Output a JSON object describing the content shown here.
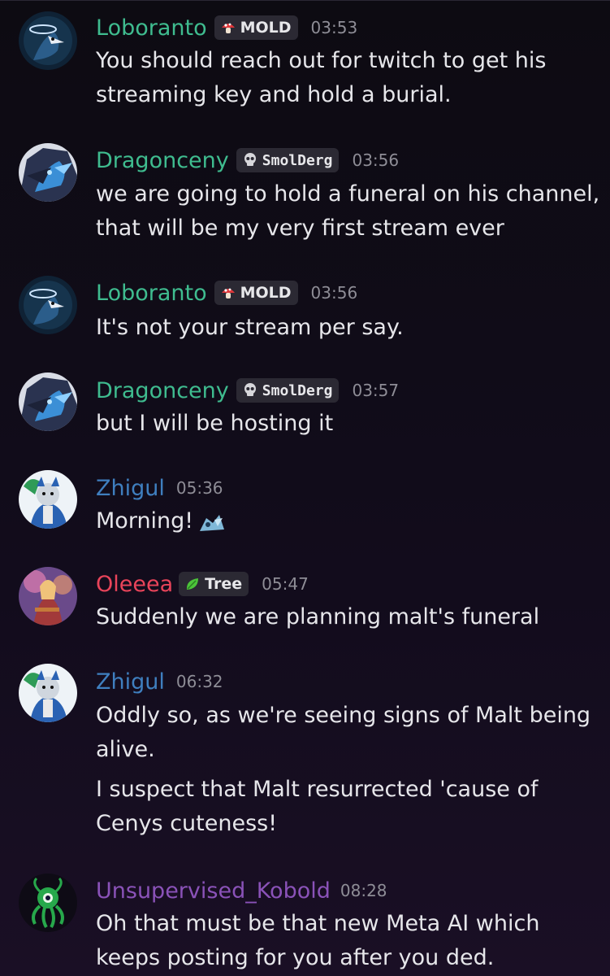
{
  "colors": {
    "loboranto": "#3fbc8f",
    "dragonceny": "#3fbc8f",
    "zhigul": "#3f7fbf",
    "oleeea": "#e9445a",
    "kobold": "#8a52b8"
  },
  "messages": [
    {
      "name": "Loboranto",
      "tag": "MOLD",
      "tag_icon": "mushroom-icon",
      "time": "03:53",
      "lines": [
        "You should reach out for twitch to get his",
        "streaming key and hold a burial."
      ]
    },
    {
      "name": "Dragonceny",
      "tag": "SmolDerg",
      "tag_icon": "skull-icon",
      "time": "03:56",
      "lines": [
        "we are going to hold a funeral on his channel,",
        "that will be my very first stream ever"
      ]
    },
    {
      "name": "Loboranto",
      "tag": "MOLD",
      "tag_icon": "mushroom-icon",
      "time": "03:56",
      "lines": [
        "It's not your stream per say."
      ]
    },
    {
      "name": "Dragonceny",
      "tag": "SmolDerg",
      "tag_icon": "skull-icon",
      "time": "03:57",
      "lines": [
        "but I will be hosting it"
      ]
    },
    {
      "name": "Zhigul",
      "time": "05:36",
      "lines": [
        "Morning!"
      ],
      "emoji": "dragon-emoji-icon"
    },
    {
      "name": "Oleeea",
      "tag": "Tree",
      "tag_icon": "leaf-icon",
      "time": "05:47",
      "lines": [
        "Suddenly we are planning malt's funeral"
      ]
    },
    {
      "name": "Zhigul",
      "time": "06:32",
      "lines": [
        "Oddly so, as we're seeing signs of Malt being",
        "alive."
      ],
      "followup": [
        "I suspect that Malt resurrected 'cause of",
        "Cenys cuteness!"
      ]
    },
    {
      "name": "Unsupervised_Kobold",
      "time": "08:28",
      "lines": [
        "Oh that must be that new Meta AI which",
        "keeps posting for you after you ded."
      ]
    }
  ]
}
